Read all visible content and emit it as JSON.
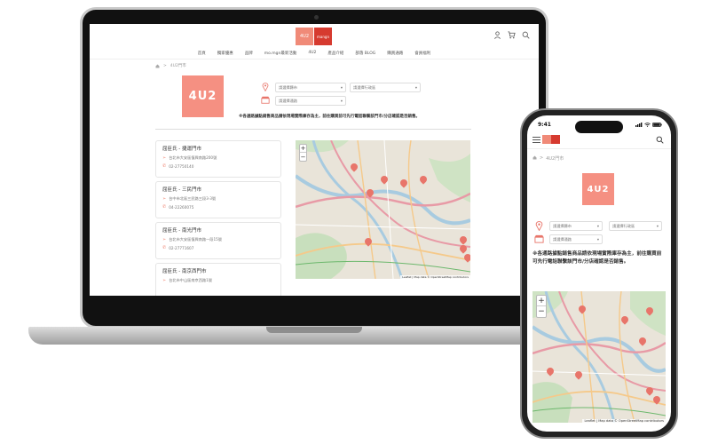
{
  "brand": {
    "logo_main": "4U2",
    "logo_sub": "",
    "secondary_logo": "mangn",
    "accent_color": "#f59082",
    "brand_red": "#d63a2f"
  },
  "nav": {
    "items": [
      "首頁",
      "獨家優惠",
      "品牌",
      "mo.mgn最新活動",
      "4U2",
      "產品介紹",
      "部落 BLOG",
      "購買通路",
      "會員福利"
    ]
  },
  "breadcrumb": {
    "home_icon": "home-icon",
    "separator": ">",
    "current": "4U2門市"
  },
  "filters": {
    "city_placeholder": "請選擇縣市",
    "district_placeholder": "請選擇行政區",
    "channel_placeholder": "請選擇通路"
  },
  "notice": "※各通路據點銷售商品請依現場實際庫存為主，前往購買前可先行電話聯繫該門市/分店確認是否銷售。",
  "stores": [
    {
      "name": "屈臣氏 - 捷運門市",
      "address": "台北市大安區復興南路200號",
      "phone": "02-27750140"
    },
    {
      "name": "屈臣氏 - 三民門市",
      "address": "台中市北區三民路三段3-3號",
      "phone": "04-22260075"
    },
    {
      "name": "屈臣氏 - 南光門市",
      "address": "台北市大安區復興南路一段15號",
      "phone": "02-27771607"
    },
    {
      "name": "屈臣氏 - 南京西門市",
      "address": "台北市中山區南京西路1號",
      "phone": ""
    }
  ],
  "map": {
    "zoom_in": "+",
    "zoom_out": "−",
    "attribution": "Leaflet | Map data © OpenStreetMap contributors",
    "pin_color": "#e8756a"
  },
  "phone": {
    "time": "9:41",
    "breadcrumb_current": "4U2門市",
    "logo_main": "4U2"
  }
}
